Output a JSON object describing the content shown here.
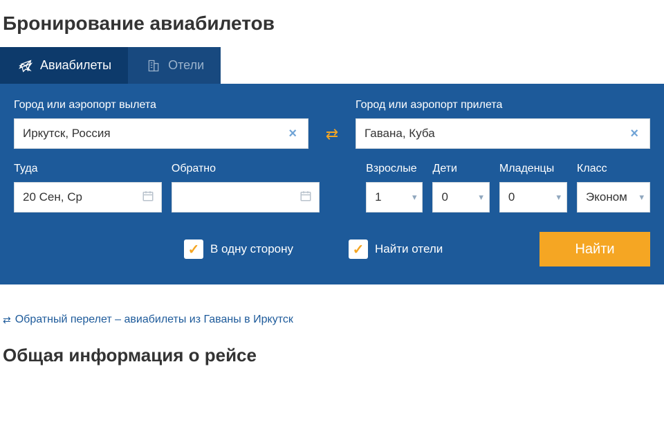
{
  "page_title": "Бронирование авиабилетов",
  "tabs": {
    "flights": "Авиабилеты",
    "hotels": "Отели"
  },
  "search": {
    "from_label": "Город или аэропорт вылета",
    "from_value": "Иркутск, Россия",
    "to_label": "Город или аэропорт прилета",
    "to_value": "Гавана, Куба",
    "depart_label": "Туда",
    "depart_value": "20 Сен, Ср",
    "return_label": "Обратно",
    "return_value": "",
    "adults_label": "Взрослые",
    "adults_value": "1",
    "children_label": "Дети",
    "children_value": "0",
    "infants_label": "Младенцы",
    "infants_value": "0",
    "class_label": "Класс",
    "class_value": "Эконом",
    "one_way_label": "В одну сторону",
    "one_way_checked": true,
    "find_hotels_label": "Найти отели",
    "find_hotels_checked": true,
    "find_button": "Найти"
  },
  "return_link": "Обратный перелет – авиабилеты из Гаваны в Иркутск",
  "section_title": "Общая информация о рейсе"
}
